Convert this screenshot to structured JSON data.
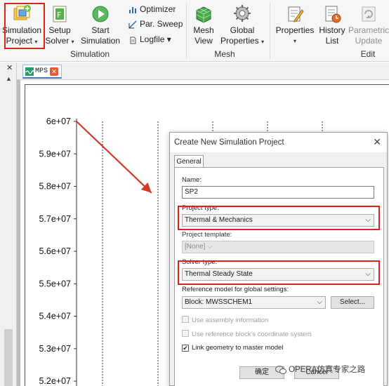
{
  "ribbon": {
    "simulation_project": {
      "line1": "Simulation",
      "line2": "Project"
    },
    "setup_solver": {
      "line1": "Setup",
      "line2": "Solver"
    },
    "start_simulation": {
      "line1": "Start",
      "line2": "Simulation"
    },
    "optimizer": "Optimizer",
    "par_sweep": "Par. Sweep",
    "logfile": "Logfile",
    "simulation_group": "Simulation",
    "mesh_view": {
      "line1": "Mesh",
      "line2": "View"
    },
    "global_properties": {
      "line1": "Global",
      "line2": "Properties"
    },
    "mesh_group": "Mesh",
    "properties": "Properties",
    "history_list": {
      "line1": "History",
      "line2": "List"
    },
    "parametric_update": {
      "line1": "Parametric",
      "line2": "Update"
    },
    "edit_group": "Edit",
    "dropdown_glyph": "▾"
  },
  "left_strip": {
    "close": "✕",
    "scroll_up": "▲"
  },
  "tab": {
    "label": "MPS",
    "close": "✕"
  },
  "chart_data": {
    "type": "line",
    "y_tick_labels": [
      "6e+07",
      "5.9e+07",
      "5.8e+07",
      "5.7e+07",
      "5.6e+07",
      "5.5e+07",
      "5.4e+07",
      "5.3e+07",
      "5.2e+07"
    ],
    "y_ticks": [
      60000000,
      59000000,
      58000000,
      57000000,
      56000000,
      55000000,
      54000000,
      53000000,
      52000000
    ],
    "ylim": [
      51850000,
      60000000
    ],
    "grid": "dashed vertical",
    "series": [
      {
        "x": [
          0,
          0.24
        ],
        "y": [
          60000000,
          57800000
        ]
      }
    ]
  },
  "dialog": {
    "title": "Create New Simulation Project",
    "close": "✕",
    "tab": "General",
    "name_label": "Name:",
    "name_value": "SP2",
    "project_type_label": "Project type:",
    "project_type_value": "Thermal & Mechanics",
    "project_template_label": "Project template:",
    "project_template_value": "[None]",
    "solver_type_label": "Solver type:",
    "solver_type_value": "Thermal Steady State",
    "reference_model_label": "Reference model for global settings:",
    "reference_model_value": "Block: MWSSCHEM1",
    "select_button": "Select...",
    "use_assembly_info": "Use assembly information",
    "use_reference_block_cs": "Use reference block's coordinate system",
    "link_geometry": "Link geometry to master model",
    "link_geometry_checked": "✔",
    "ok_button": "确定",
    "cancel_button": "Cancel",
    "combo_arrow": "⌵"
  },
  "watermark": "OPERA仿真专家之路",
  "colors": {
    "highlight": "#e0201b",
    "annotation_arrow": "#e0201b",
    "axis": "#555555"
  }
}
